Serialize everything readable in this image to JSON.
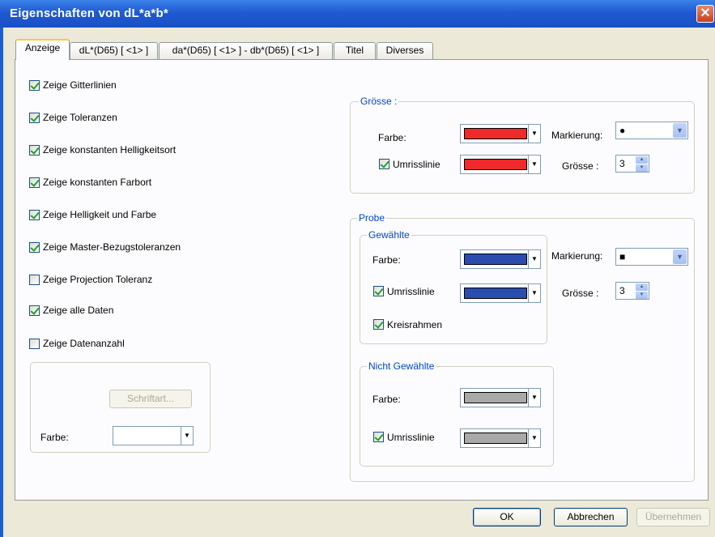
{
  "window": {
    "title": "Eigenschaften von dL*a*b*",
    "close": "✕"
  },
  "tabs": [
    {
      "label": "Anzeige"
    },
    {
      "label": "dL*(D65) [ <1> ]"
    },
    {
      "label": "da*(D65) [ <1> ] - db*(D65) [ <1> ]"
    },
    {
      "label": "Titel"
    },
    {
      "label": "Diverses"
    }
  ],
  "options": [
    {
      "label": "Zeige Gitterlinien",
      "checked": true
    },
    {
      "label": "Zeige Toleranzen",
      "checked": true
    },
    {
      "label": "Zeige konstanten Helligkeitsort",
      "checked": true
    },
    {
      "label": "Zeige konstanten Farbort",
      "checked": true
    },
    {
      "label": "Zeige Helligkeit und Farbe",
      "checked": true
    },
    {
      "label": "Zeige Master-Bezugstoleranzen",
      "checked": true
    },
    {
      "label": "Zeige Projection Toleranz",
      "checked": false
    },
    {
      "label": "Zeige alle Daten",
      "checked": true
    },
    {
      "label": "Zeige Datenanzahl",
      "checked": false
    }
  ],
  "font_group": {
    "font_button": "Schriftart...",
    "color_label": "Farbe:",
    "color": "#ffffff"
  },
  "groesse": {
    "title": "Grösse :",
    "farbe_label": "Farbe:",
    "farbe_color": "#ef2a2a",
    "umriss_label": "Umrisslinie",
    "umriss_checked": true,
    "umriss_color": "#ef2a2a",
    "markierung_label": "Markierung:",
    "markierung_value": "●",
    "groesse_label": "Grösse :",
    "groesse_value": "3"
  },
  "probe": {
    "title": "Probe",
    "gewaehlte": {
      "title": "Gewählte",
      "farbe_label": "Farbe:",
      "farbe_color": "#2a4dae",
      "umriss_label": "Umrisslinie",
      "umriss_checked": true,
      "umriss_color": "#2a4dae",
      "kreis_label": "Kreisrahmen",
      "kreis_checked": true
    },
    "markierung_label": "Markierung:",
    "markierung_value": "■",
    "groesse_label": "Grösse :",
    "groesse_value": "3",
    "nicht_gewaehlte": {
      "title": "Nicht Gewählte",
      "farbe_label": "Farbe:",
      "farbe_color": "#a9a9a9",
      "umriss_label": "Umrisslinie",
      "umriss_checked": true,
      "umriss_color": "#a9a9a9"
    }
  },
  "buttons": {
    "ok": "OK",
    "cancel": "Abbrechen",
    "apply": "Übernehmen"
  }
}
